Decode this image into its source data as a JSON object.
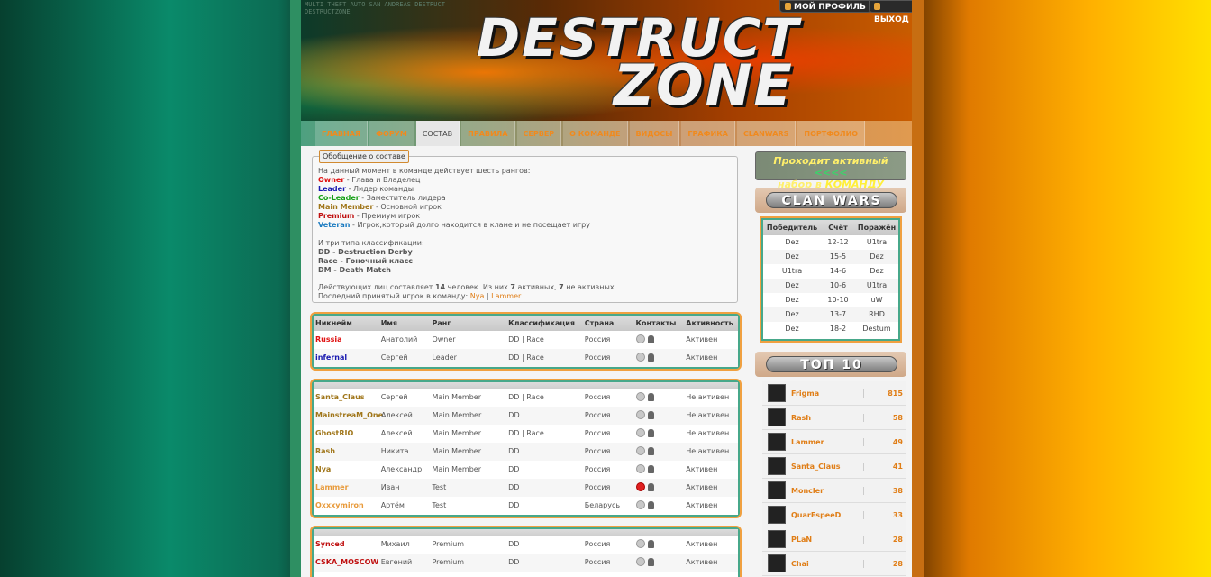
{
  "header": {
    "tiny_caption": "MULTI THEFT AUTO SAN ANDREAS DESTRUCT DESTRUCTZONE",
    "logo_line1": "DESTRUCT",
    "logo_line2": "ZONE",
    "profile_btn": "МОЙ ПРОФИЛЬ",
    "logout_btn": "ВЫХОД"
  },
  "nav": [
    {
      "label": "ГЛАВНАЯ"
    },
    {
      "label": "ФОРУМ"
    },
    {
      "label": "СОСТАВ"
    },
    {
      "label": "ПРАВИЛА"
    },
    {
      "label": "СЕРВЕР"
    },
    {
      "label": "О КОМАНДЕ"
    },
    {
      "label": "ВИДОСЫ"
    },
    {
      "label": "ГРАФИКА"
    },
    {
      "label": "CLANWARS"
    },
    {
      "label": "ПОРТФОЛИО"
    }
  ],
  "summary": {
    "legend": "Обобщение о составе",
    "intro": "На данный момент в команде действует шесть рангов:",
    "ranks": [
      {
        "name": "Owner",
        "desc": " - Глава и Владелец",
        "color": "#e01010"
      },
      {
        "name": "Leader",
        "desc": " - Лидер команды",
        "color": "#1a1ab0"
      },
      {
        "name": "Co-Leader",
        "desc": " - Заместитель лидера",
        "color": "#16a016"
      },
      {
        "name": "Main Member",
        "desc": " - Основной игрок",
        "color": "#a0761a"
      },
      {
        "name": "Premium",
        "desc": " - Премиум игрок",
        "color": "#c01010"
      },
      {
        "name": "Veteran",
        "desc": " - Игрок,который долго находится в клане и не посещает игру",
        "color": "#1a7ac0"
      }
    ],
    "class_intro": "И три типа классификации:",
    "classes": [
      "DD - Destruction Derby",
      "Race - Гоночный класс",
      "DM - Death Match"
    ],
    "active_line_a": "Действующих лиц составляет ",
    "active_total": "14",
    "active_line_b": " человек. Из них ",
    "active_count": "7",
    "active_line_c": " активных, ",
    "inactive_count": "7",
    "active_line_d": " не активных.",
    "last_line": "Последний принятый игрок в команду: ",
    "last_a": "Nya",
    "last_sep": " | ",
    "last_b": "Lammer"
  },
  "table": {
    "columns": [
      "Никнейм",
      "Имя",
      "Ранг",
      "Классификация",
      "Страна",
      "Контакты",
      "Активность"
    ],
    "group1": [
      {
        "nick": "Russia",
        "name": "Анатолий",
        "rank": "Owner",
        "cls": "DD | Race",
        "country": "Россия",
        "status": "Активен",
        "color": "#e01010"
      },
      {
        "nick": "infernal",
        "name": "Сергей",
        "rank": "Leader",
        "cls": "DD | Race",
        "country": "Россия",
        "status": "Активен",
        "color": "#1a1ab0"
      }
    ],
    "group2": [
      {
        "nick": "Santa_Claus",
        "name": "Сергей",
        "rank": "Main Member",
        "cls": "DD | Race",
        "country": "Россия",
        "status": "Не активен",
        "color": "#a0761a"
      },
      {
        "nick": "MainstreaM_One",
        "name": "Алексей",
        "rank": "Main Member",
        "cls": "DD",
        "country": "Россия",
        "status": "Не активен",
        "color": "#a0761a"
      },
      {
        "nick": "GhostRIO",
        "name": "Алексей",
        "rank": "Main Member",
        "cls": "DD | Race",
        "country": "Россия",
        "status": "Не активен",
        "color": "#a0761a"
      },
      {
        "nick": "Rash",
        "name": "Никита",
        "rank": "Main Member",
        "cls": "DD",
        "country": "Россия",
        "status": "Не активен",
        "color": "#a0761a"
      },
      {
        "nick": "Nya",
        "name": "Александр",
        "rank": "Main Member",
        "cls": "DD",
        "country": "Россия",
        "status": "Активен",
        "color": "#a0761a"
      },
      {
        "nick": "Lammer",
        "name": "Иван",
        "rank": "Test",
        "cls": "DD",
        "country": "Россия",
        "status": "Активен",
        "color": "#e89a3a"
      },
      {
        "nick": "Oxxxymiron",
        "name": "Артём",
        "rank": "Test",
        "cls": "DD",
        "country": "Беларусь",
        "status": "Активен",
        "color": "#e89a3a"
      }
    ],
    "group3": [
      {
        "nick": "Synced",
        "name": "Михаил",
        "rank": "Premium",
        "cls": "DD",
        "country": "Россия",
        "status": "Активен",
        "color": "#c01010"
      },
      {
        "nick": "CSKA_MOSCOW",
        "name": "Евгений",
        "rank": "Premium",
        "cls": "DD",
        "country": "Россия",
        "status": "Активен",
        "color": "#c01010"
      }
    ]
  },
  "sidebar": {
    "banner_l1": "Проходит активный",
    "banner_arrows": "<<<<",
    "banner_l2": "набор в ",
    "banner_bold": "КОМАНДУ",
    "clanwars_title": "CLAN WARS",
    "cw_cols": [
      "Победитель",
      "Счёт",
      "Поражён"
    ],
    "cw_rows": [
      [
        "Dez",
        "12-12",
        "U1tra"
      ],
      [
        "Dez",
        "15-5",
        "Dez"
      ],
      [
        "U1tra",
        "14-6",
        "Dez"
      ],
      [
        "Dez",
        "10-6",
        "U1tra"
      ],
      [
        "Dez",
        "10-10",
        "uW"
      ],
      [
        "Dez",
        "13-7",
        "RHD"
      ],
      [
        "Dez",
        "18-2",
        "Destum"
      ]
    ],
    "top10_title": "ТОП 10",
    "top10": [
      {
        "name": "Frigma",
        "value": "815"
      },
      {
        "name": "Rash",
        "value": "58"
      },
      {
        "name": "Lammer",
        "value": "49"
      },
      {
        "name": "Santa_Claus",
        "value": "41"
      },
      {
        "name": "Moncler",
        "value": "38"
      },
      {
        "name": "QuarEspeeD",
        "value": "33"
      },
      {
        "name": "PLaN",
        "value": "28"
      },
      {
        "name": "Chai",
        "value": "28"
      }
    ]
  }
}
